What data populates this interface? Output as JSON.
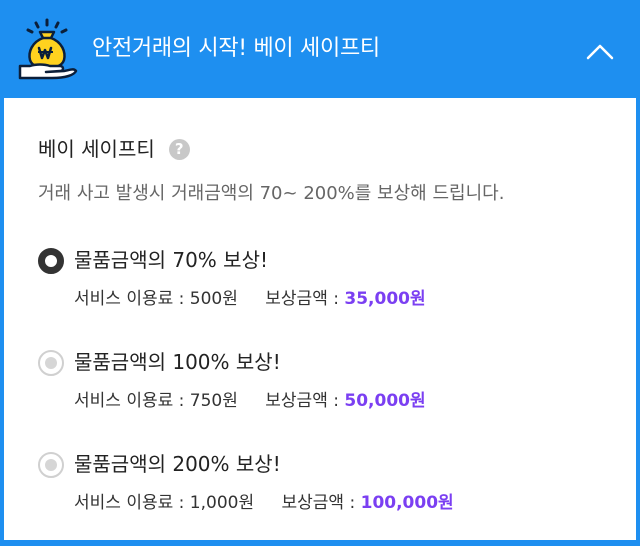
{
  "header": {
    "title": "안전거래의 시작! 베이 세이프티"
  },
  "section": {
    "title": "베이 세이프티",
    "help": "?",
    "description": "거래 사고 발생시 거래금액의 70~ 200%를 보상해 드립니다."
  },
  "options": [
    {
      "label": "물품금액의 70% 보상!",
      "fee_label": "서비스 이용료 :",
      "fee_value": "500원",
      "reward_label": "보상금액 :",
      "reward_value": "35,000원",
      "selected": true
    },
    {
      "label": "물품금액의 100% 보상!",
      "fee_label": "서비스 이용료 :",
      "fee_value": "750원",
      "reward_label": "보상금액 :",
      "reward_value": "50,000원",
      "selected": false
    },
    {
      "label": "물품금액의 200% 보상!",
      "fee_label": "서비스 이용료 :",
      "fee_value": "1,000원",
      "reward_label": "보상금액 :",
      "reward_value": "100,000원",
      "selected": false
    }
  ],
  "colors": {
    "header_bg": "#1e8ff0",
    "accent_amount": "#7b3ff2",
    "logo_yellow": "#ffd21f"
  },
  "icons": {
    "logo": "money-bag-hand-icon",
    "collapse": "chevron-up-icon",
    "help": "question-circle-icon"
  }
}
